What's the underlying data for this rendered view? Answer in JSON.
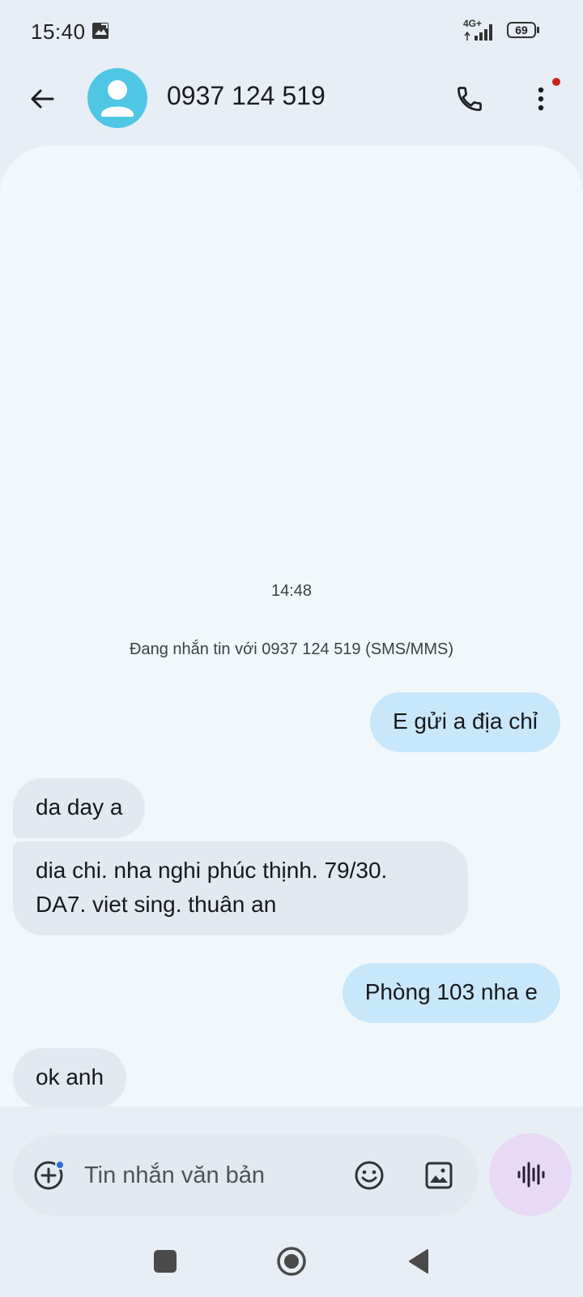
{
  "status_bar": {
    "time": "15:40",
    "network": "4G+",
    "battery": "69"
  },
  "header": {
    "title": "0937 124 519",
    "icons": [
      "back-arrow-icon",
      "contact-avatar",
      "phone-icon",
      "more-vert-icon"
    ]
  },
  "conversation": {
    "timestamp": "14:48",
    "info": "Đang nhắn tin với 0937 124 519 (SMS/MMS)",
    "messages": [
      {
        "direction": "outgoing",
        "text": "E gửi a địa chỉ"
      },
      {
        "direction": "incoming",
        "text": "da day a"
      },
      {
        "direction": "incoming",
        "lines": [
          "dia chi. nha nghi phúc thịnh. 79/30.",
          "DA7. viet sing. thuân an"
        ]
      },
      {
        "direction": "outgoing",
        "text": "Phòng 103 nha e"
      },
      {
        "direction": "incoming",
        "text": "ok anh"
      }
    ]
  },
  "composer": {
    "placeholder": "Tin nhắn văn bản",
    "value": ""
  },
  "colors": {
    "outgoing_bubble": "#c9e7fb",
    "incoming_bubble": "#e3e9f0",
    "avatar": "#4fc7e4",
    "voice_button": "#e8daf6"
  }
}
